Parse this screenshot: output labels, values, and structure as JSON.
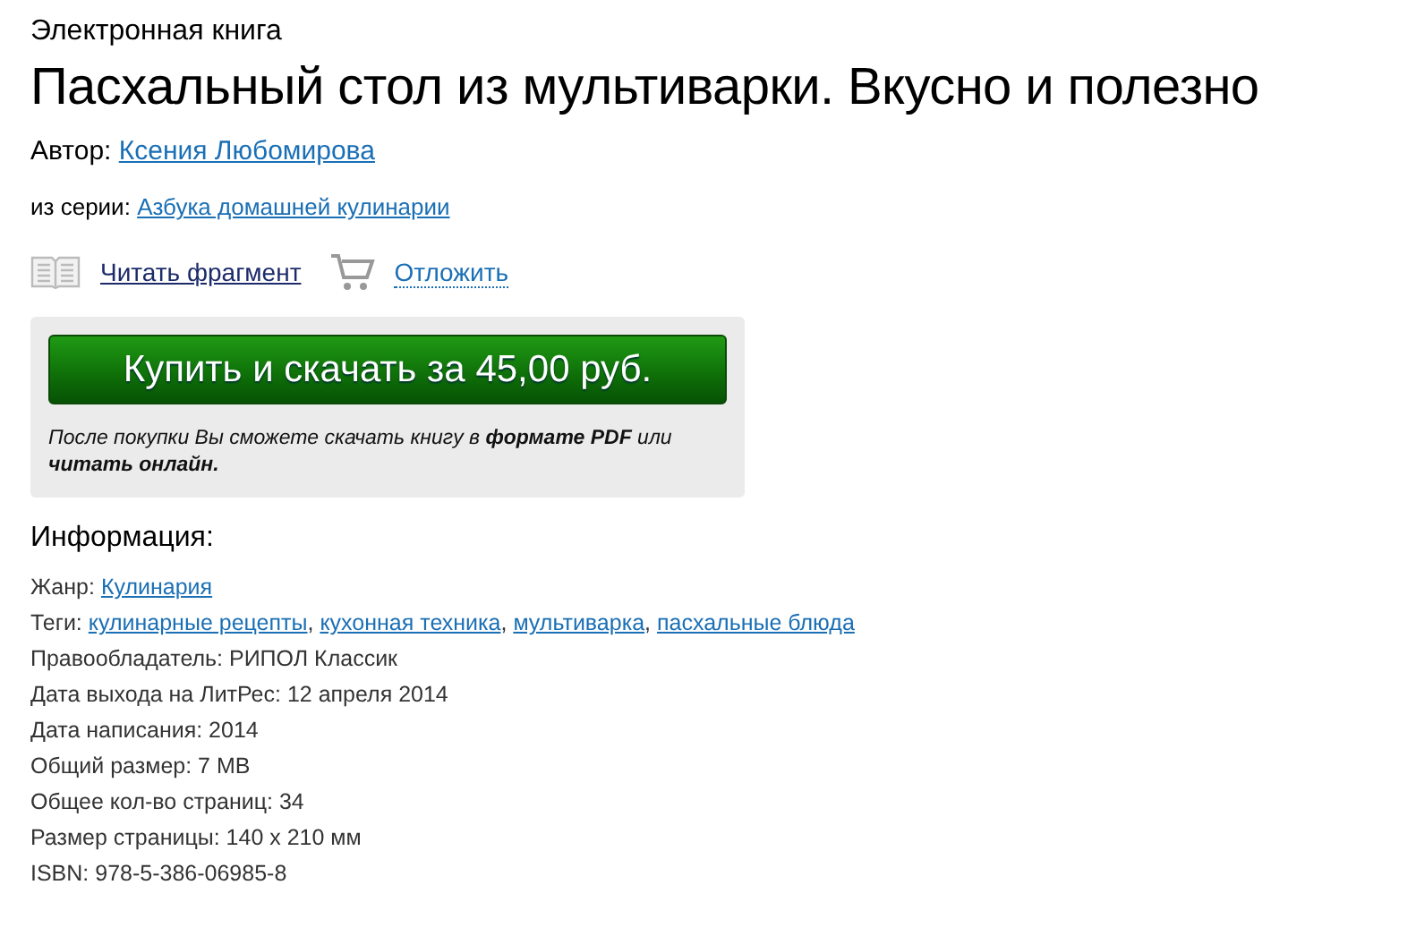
{
  "category": "Электронная книга",
  "title": "Пасхальный стол из мультиварки. Вкусно и полезно",
  "author": {
    "label": "Автор:",
    "name": "Ксения Любомирова"
  },
  "series": {
    "label": "из серии:",
    "name": "Азбука домашней кулинарии"
  },
  "actions": [
    {
      "kind": "read",
      "label": "Читать фрагмент"
    },
    {
      "kind": "cart",
      "label": "Отложить"
    }
  ],
  "purchase": {
    "button": "Купить и скачать за 45,00 руб.",
    "note": "После покупки Вы сможете скачать книгу в **формате PDF** или **читать онлайн.**"
  },
  "info": {
    "heading": "Информация:",
    "rows": [
      {
        "kind": "links",
        "label": "Жанр:",
        "links": [
          {
            "text": "Кулинария"
          }
        ]
      },
      {
        "kind": "links",
        "label": "Теги:",
        "links": [
          {
            "text": "кулинарные рецепты",
            "after": ","
          },
          {
            "text": "кухонная техника",
            "after": ","
          },
          {
            "text": "мультиварка",
            "after": ","
          },
          {
            "text": "пасхальные блюда"
          }
        ]
      },
      {
        "kind": "text",
        "text": "Правообладатель: РИПОЛ Классик"
      },
      {
        "kind": "text",
        "text": "Дата выхода на ЛитРес: 12 апреля 2014"
      },
      {
        "kind": "text",
        "text": "Дата написания: 2014"
      },
      {
        "kind": "text",
        "text": "Общий размер: 7 MB"
      },
      {
        "kind": "text",
        "text": "Общее кол-во страниц: 34"
      },
      {
        "kind": "text",
        "text": "Размер страницы: 140 x 210 мм"
      },
      {
        "kind": "text",
        "text": "ISBN: 978-5-386-06985-8"
      }
    ]
  }
}
